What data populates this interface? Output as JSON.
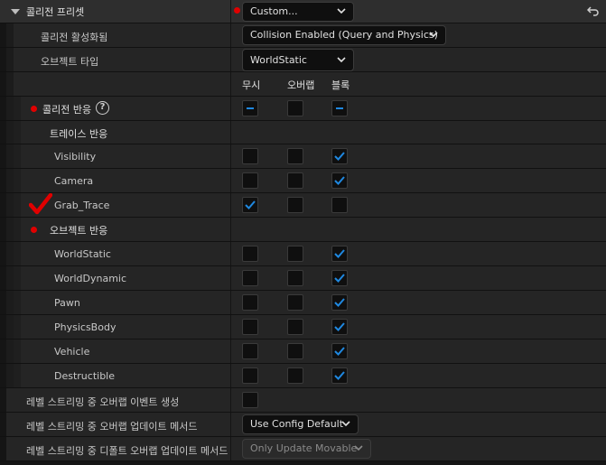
{
  "header": {
    "title": "콜리전 프리셋",
    "preset_value": "Custom..."
  },
  "rows": {
    "collision_enabled": {
      "label": "콜리전 활성화됨",
      "value": "Collision Enabled (Query and Physics)"
    },
    "object_type": {
      "label": "오브젝트 타입",
      "value": "WorldStatic"
    },
    "columns": {
      "ignore": "무시",
      "overlap": "오버랩",
      "block": "블록"
    },
    "collision_response": {
      "label": "콜리전 반응",
      "help": "?"
    },
    "trace_response": {
      "label": "트레이스 반응"
    },
    "object_response": {
      "label": "오브젝트 반응"
    }
  },
  "trace_channels": [
    {
      "label": "Visibility",
      "state": "block"
    },
    {
      "label": "Camera",
      "state": "block"
    },
    {
      "label": "Grab_Trace",
      "state": "ignore"
    }
  ],
  "object_channels": [
    {
      "label": "WorldStatic",
      "state": "block"
    },
    {
      "label": "WorldDynamic",
      "state": "block"
    },
    {
      "label": "Pawn",
      "state": "block"
    },
    {
      "label": "PhysicsBody",
      "state": "block"
    },
    {
      "label": "Vehicle",
      "state": "block"
    },
    {
      "label": "Destructible",
      "state": "block"
    }
  ],
  "footer": {
    "generate_overlap_label": "레벨 스트리밍 중 오버랩 이벤트 생성",
    "update_method_label": "레벨 스트리밍 중 오버랩 업데이트 메서드",
    "update_method_value": "Use Config Default",
    "default_update_method_label": "레벨 스트리밍 중 디폴트 오버랩 업데이트 메서드",
    "default_update_method_value": "Only Update Movable"
  },
  "colors": {
    "accent": "#1f88e0",
    "marker_red": "#e00000",
    "row_bg": "#252525",
    "field_bg": "#0f0f0f"
  }
}
